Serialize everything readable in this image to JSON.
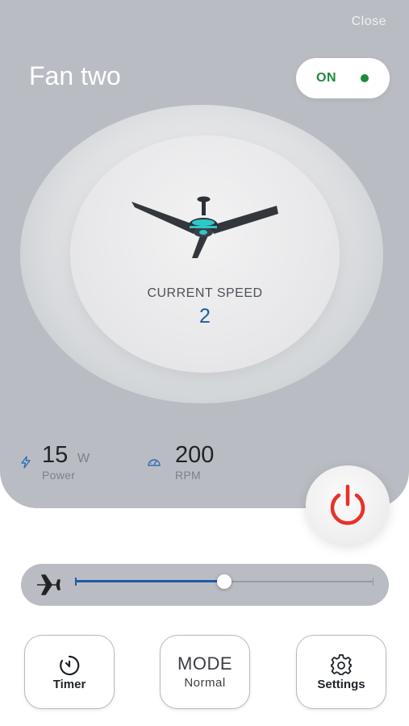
{
  "header": {
    "close_label": "Close",
    "title": "Fan two",
    "toggle_label": "ON",
    "toggle_status_color": "#1e8a3a"
  },
  "dial": {
    "caption": "CURRENT SPEED",
    "value": "2",
    "fan_icon": "ceiling-fan-icon"
  },
  "stats": {
    "power": {
      "value": "15",
      "unit": "W",
      "label": "Power",
      "icon": "lightning-icon"
    },
    "rpm": {
      "value": "200",
      "label": "RPM",
      "icon": "gauge-icon"
    }
  },
  "power_button": {
    "icon": "power-icon",
    "color": "#e8312a"
  },
  "speed_slider": {
    "icon": "airplane-icon",
    "level_fraction": 0.5
  },
  "actions": {
    "timer": {
      "label": "Timer",
      "icon": "timer-icon"
    },
    "mode": {
      "title": "MODE",
      "value": "Normal"
    },
    "settings": {
      "label": "Settings",
      "icon": "gear-icon"
    }
  },
  "colors": {
    "panel": "#b9bdc3",
    "accent_blue": "#1f5aa6",
    "fan_accent": "#2ec8c8"
  }
}
